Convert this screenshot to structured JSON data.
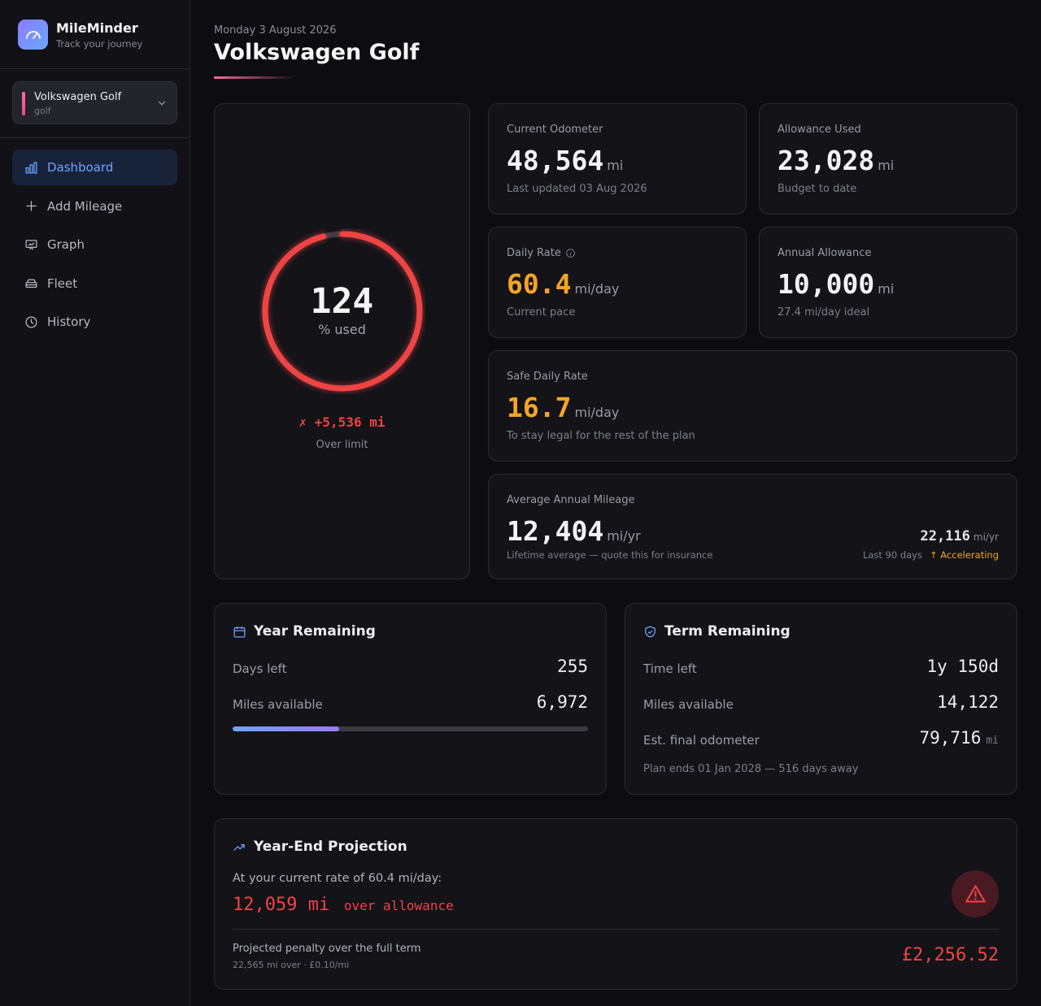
{
  "app": {
    "name": "MileMinder",
    "tagline": "Track your journey"
  },
  "vehicle_selector": {
    "name": "Volkswagen Golf",
    "sub": "golf"
  },
  "nav": [
    {
      "label": "Dashboard",
      "icon": "bar-chart-icon",
      "active": true
    },
    {
      "label": "Add Mileage",
      "icon": "plus-icon"
    },
    {
      "label": "Graph",
      "icon": "presentation-chart-icon"
    },
    {
      "label": "Fleet",
      "icon": "car-icon"
    },
    {
      "label": "History",
      "icon": "clock-icon"
    }
  ],
  "header": {
    "date": "Monday 3 August 2026",
    "title": "Volkswagen Golf"
  },
  "gauge": {
    "value": "124",
    "value_pct": 124,
    "label": "% used",
    "over_text": "✗ +5,536 mi",
    "over_label": "Over limit"
  },
  "stats": {
    "odometer": {
      "label": "Current Odometer",
      "value": "48,564",
      "unit": "mi",
      "sub": "Last updated 03 Aug 2026"
    },
    "allowance_used": {
      "label": "Allowance Used",
      "value": "23,028",
      "unit": "mi",
      "sub": "Budget to date"
    },
    "daily_rate": {
      "label": "Daily Rate",
      "value": "60.4",
      "unit": "mi/day",
      "sub": "Current pace"
    },
    "annual_allowance": {
      "label": "Annual Allowance",
      "value": "10,000",
      "unit": "mi",
      "sub": "27.4 mi/day ideal"
    },
    "safe_daily": {
      "label": "Safe Daily Rate",
      "value": "16.7",
      "unit": "mi/day",
      "sub": "To stay legal for the rest of the plan"
    },
    "avg_annual": {
      "label": "Average Annual Mileage",
      "value": "12,404",
      "unit": "mi/yr",
      "sub": "Lifetime average — quote this for insurance",
      "recent_value": "22,116",
      "recent_unit": "mi/yr",
      "recent_label": "Last 90 days",
      "trend": "↑ Accelerating"
    }
  },
  "year_remaining": {
    "title": "Year Remaining",
    "days_label": "Days left",
    "days_value": "255",
    "miles_label": "Miles available",
    "miles_value": "6,972",
    "progress_pct": 30
  },
  "term_remaining": {
    "title": "Term Remaining",
    "time_label": "Time left",
    "time_value": "1y 150d",
    "miles_label": "Miles available",
    "miles_value": "14,122",
    "final_label": "Est. final odometer",
    "final_value": "79,716",
    "final_unit": "mi",
    "note": "Plan ends 01 Jan 2028 — 516 days away"
  },
  "projection": {
    "title": "Year-End Projection",
    "intro": "At your current rate of 60.4 mi/day:",
    "over_value": "12,059 mi",
    "over_text": "over allowance",
    "penalty_label": "Projected penalty over the full term",
    "penalty_sub": "22,565 mi over · £0.10/mi",
    "penalty_value": "£2,256.52"
  },
  "colors": {
    "accent": "#6ea4ff",
    "danger": "#ef4444",
    "warning": "#f5a524",
    "vehicle": "#ff6aa2"
  }
}
